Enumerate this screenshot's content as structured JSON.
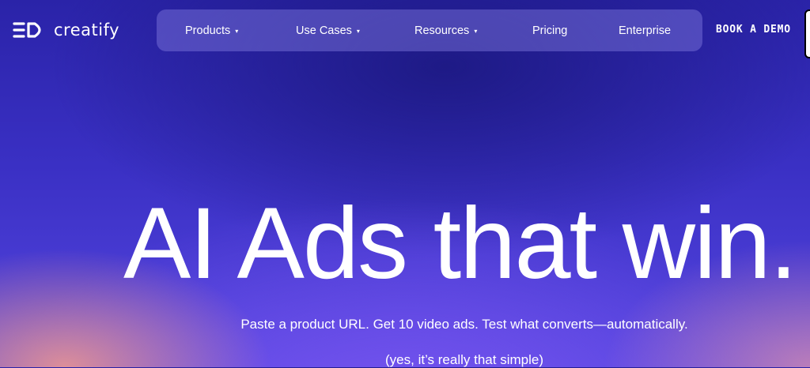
{
  "brand": {
    "name": "creatify",
    "logo_icon": "creatify-logo-icon"
  },
  "nav": {
    "items": [
      {
        "label": "Products",
        "has_dropdown": true
      },
      {
        "label": "Use Cases",
        "has_dropdown": true
      },
      {
        "label": "Resources",
        "has_dropdown": true
      },
      {
        "label": "Pricing",
        "has_dropdown": false
      },
      {
        "label": "Enterprise",
        "has_dropdown": false
      }
    ],
    "caret": "▾"
  },
  "cta": {
    "book_demo": "BOOK A DEMO"
  },
  "hero": {
    "title": "AI Ads that win.",
    "subtitle": "Paste a product URL. Get 10 video ads. Test what converts—automatically.",
    "note": "(yes, it’s really that simple)"
  },
  "colors": {
    "background_top": "#1e1a86",
    "background_mid": "#3a30c4",
    "navbar": "#6f6bd0",
    "accent_glow": "#f49b8c",
    "text": "#ffffff"
  }
}
